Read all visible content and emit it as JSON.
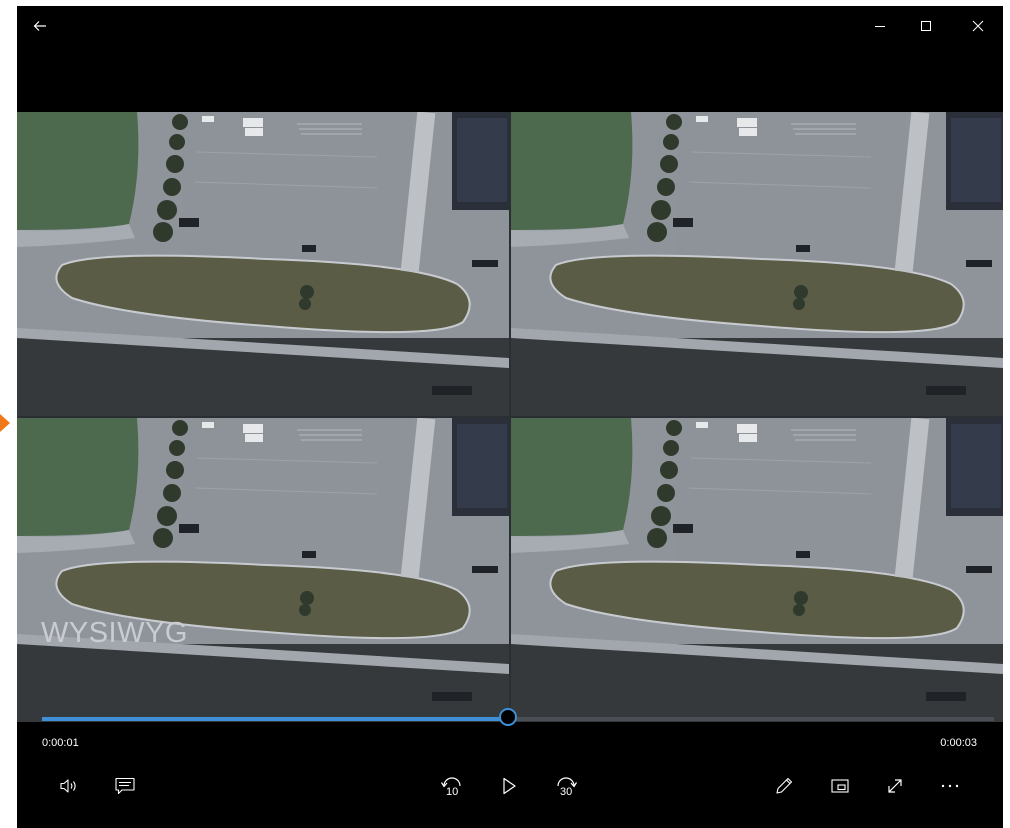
{
  "player": {
    "watermark": "WYSIWYG",
    "time_elapsed": "0:00:01",
    "time_total": "0:00:03",
    "progress": 0.49,
    "skip_back_seconds": "10",
    "skip_forward_seconds": "30"
  },
  "icons": {
    "back": "back-arrow-icon",
    "minimize": "minimize-icon",
    "maximize": "maximize-icon",
    "close": "close-icon",
    "volume": "volume-icon",
    "captions": "captions-icon",
    "skip_back": "skip-back-icon",
    "play": "play-icon",
    "skip_forward": "skip-forward-icon",
    "edit": "pencil-icon",
    "mini_view": "mini-view-icon",
    "fullscreen": "fullscreen-icon",
    "more": "more-icon"
  },
  "colors": {
    "window_bg": "#000000",
    "accent": "#3f8fd6",
    "side_marker": "#f07818"
  }
}
